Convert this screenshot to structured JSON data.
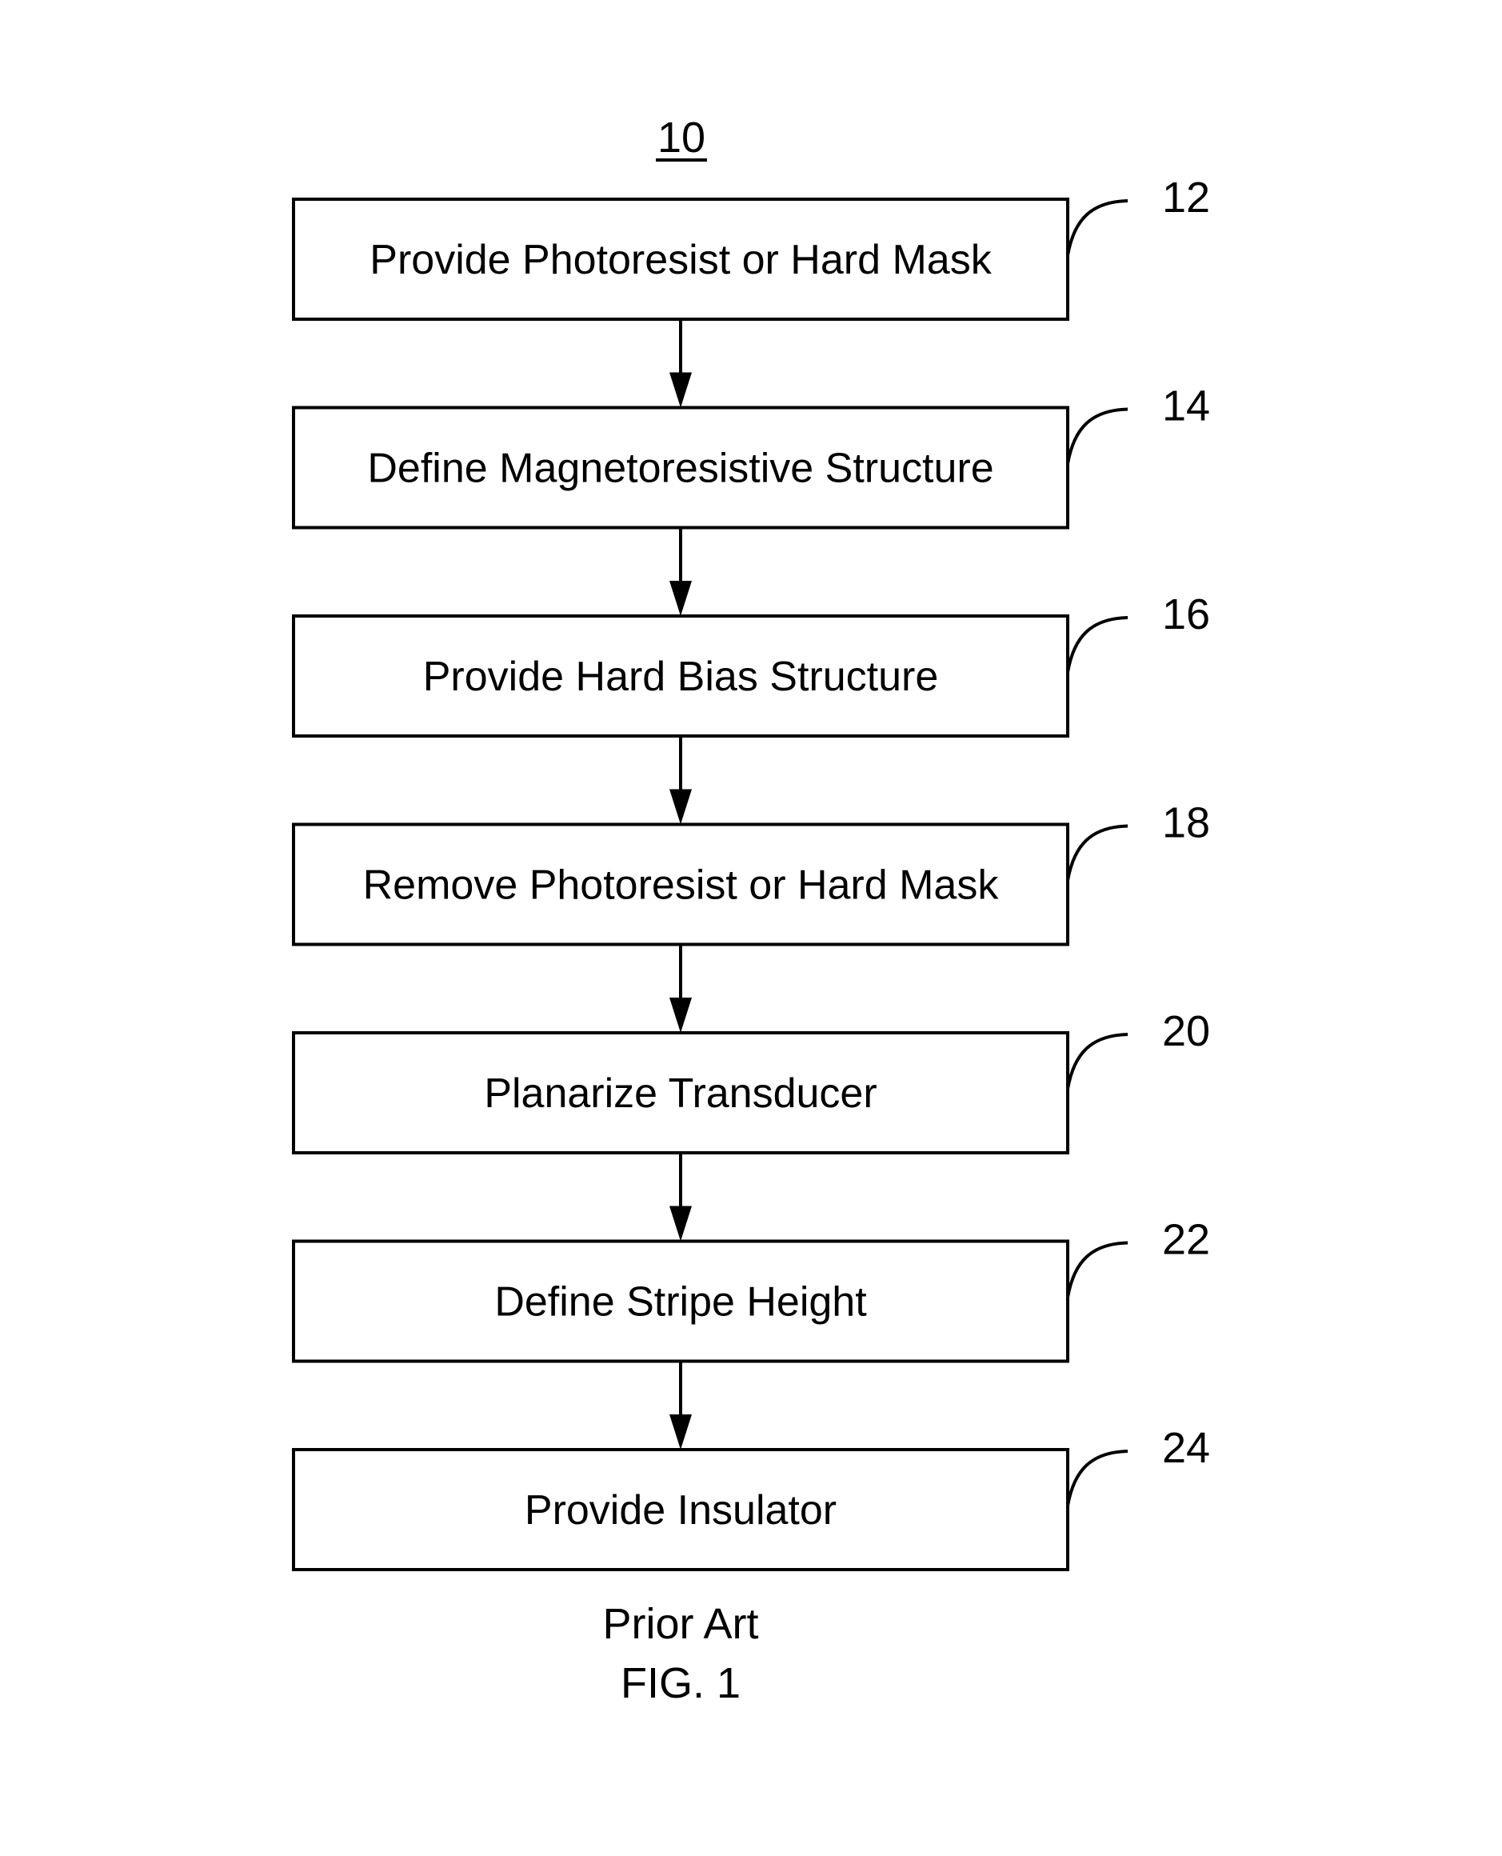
{
  "figure": {
    "reference_numeral": "10",
    "caption_line1": "Prior Art",
    "caption_line2": "FIG. 1"
  },
  "steps": [
    {
      "label": "Provide Photoresist or Hard Mask",
      "ref": "12"
    },
    {
      "label": "Define Magnetoresistive Structure",
      "ref": "14"
    },
    {
      "label": "Provide Hard Bias Structure",
      "ref": "16"
    },
    {
      "label": "Remove Photoresist or Hard Mask",
      "ref": "18"
    },
    {
      "label": "Planarize Transducer",
      "ref": "20"
    },
    {
      "label": "Define Stripe Height",
      "ref": "22"
    },
    {
      "label": "Provide Insulator",
      "ref": "24"
    }
  ]
}
